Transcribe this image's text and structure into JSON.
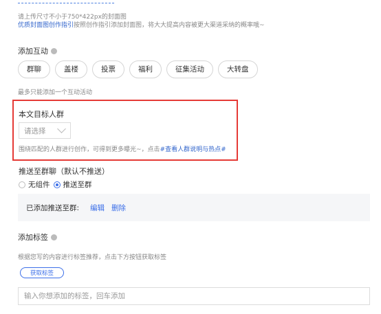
{
  "cover": {
    "hint_line1": "请上传尺寸不小于750*422px的封面图",
    "hint_link": "优质封面图创作指引",
    "hint_line2": "按照创作指引添加封面图，将大大提高内容被更大渠道采纳的概率哦~"
  },
  "interaction": {
    "title": "添加互动",
    "options": [
      "群聊",
      "盖楼",
      "投票",
      "福利",
      "征集活动",
      "大转盘"
    ],
    "limit_hint": "最多只能添加一个互动活动"
  },
  "audience": {
    "title": "本文目标人群",
    "select_placeholder": "请选择",
    "hint_text": "围绕匹配的人群进行创作，可得到更多曝光~，点击",
    "hint_link": "#查看人群说明与热点#"
  },
  "push": {
    "title": "推送至群聊（默认不推送）",
    "option_none": "无组件",
    "option_push": "推送至群",
    "selected": "推送至群",
    "added_label": "已添加推送至群:",
    "edit": "编辑",
    "delete": "删除"
  },
  "tags": {
    "title": "添加标签",
    "hint": "根据您写的内容进行标签推荐，点击下方按钮获取标签",
    "fetch_button": "获取标签",
    "input_placeholder": "输入你想添加的标签，回车添加"
  },
  "colors": {
    "accent": "#3a6ee8",
    "highlight_border": "#e53935"
  }
}
